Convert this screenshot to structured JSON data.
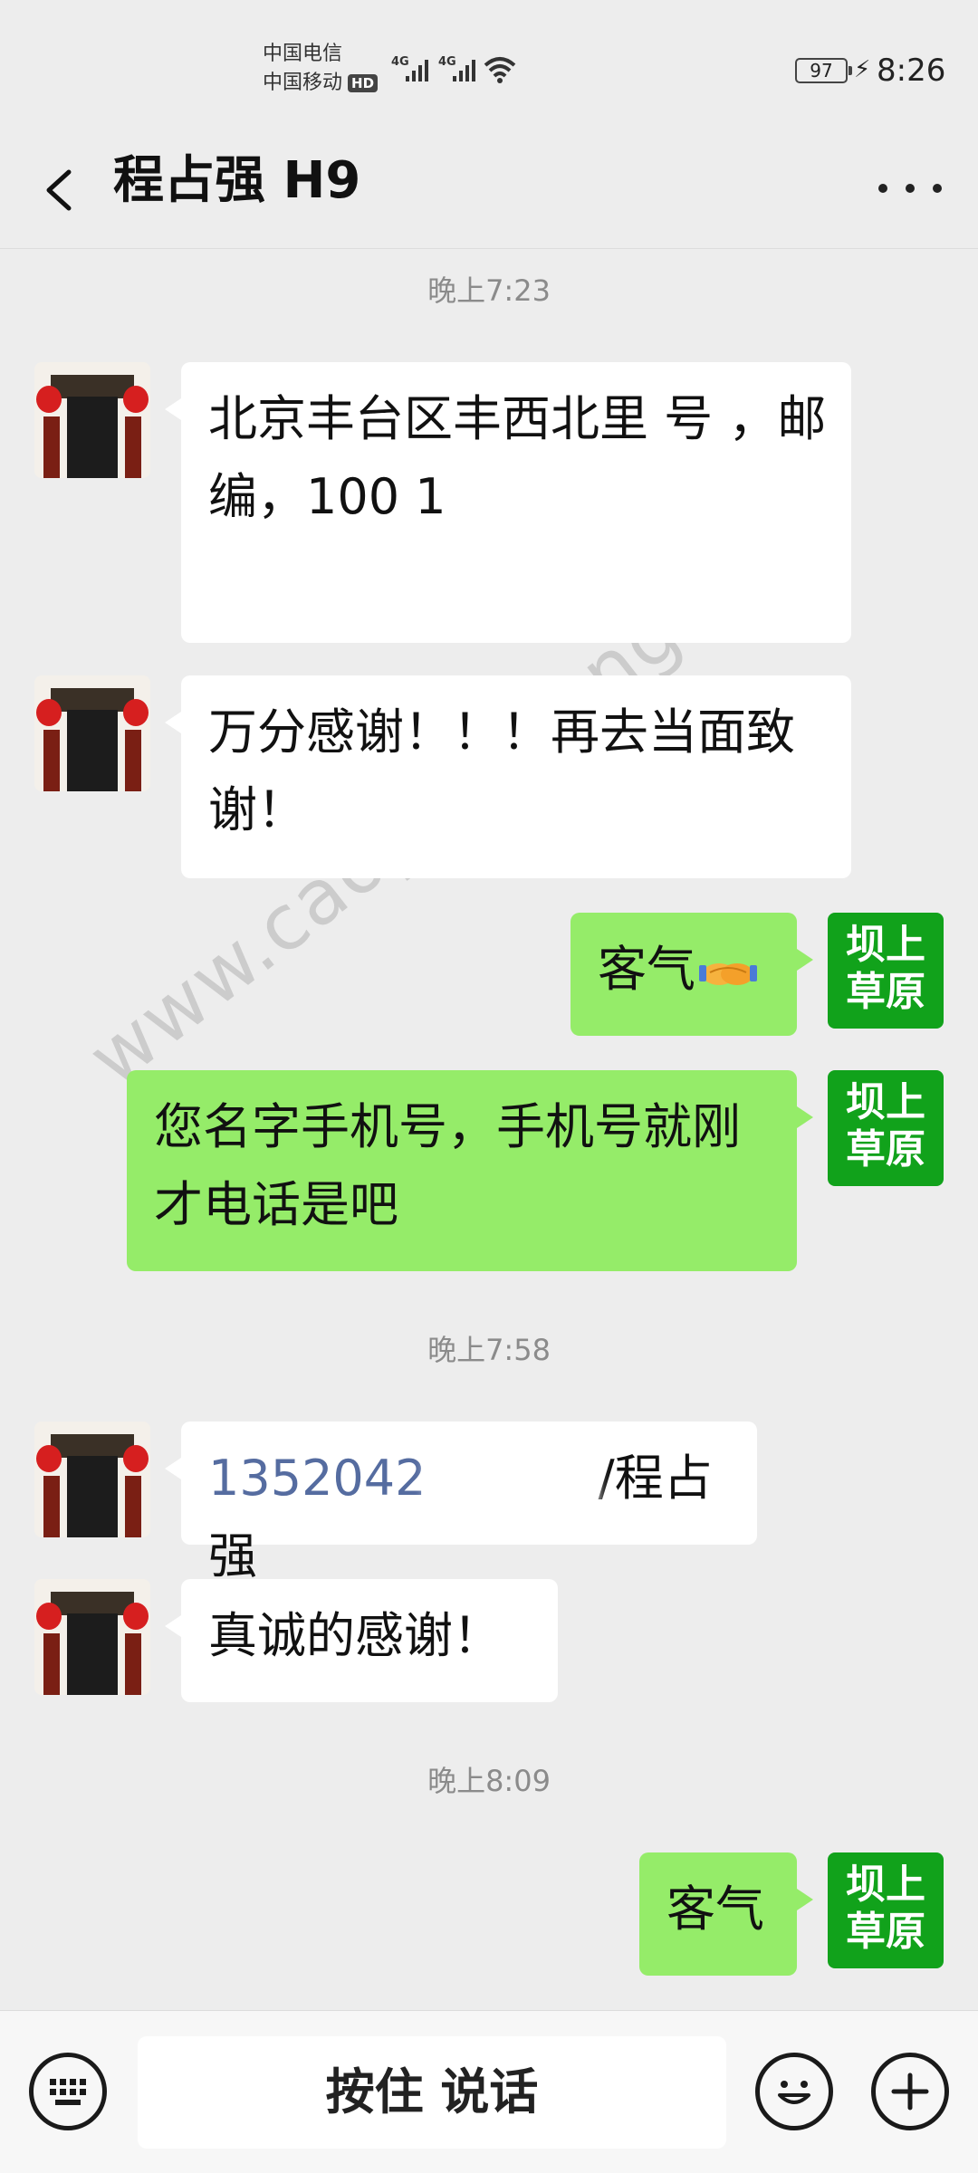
{
  "status_bar": {
    "carrier1": "中国电信",
    "carrier2": "中国移动",
    "hd": "HD",
    "network1": "4G",
    "network2": "4G",
    "battery": "97",
    "time": "8:26"
  },
  "header": {
    "title": "程占强 H9"
  },
  "messages": [
    {
      "type": "time",
      "text": "晚上7:23"
    },
    {
      "type": "in",
      "text": "北京丰台区丰西北里 号 ，邮编，100 1"
    },
    {
      "type": "in",
      "text": "万分感谢！！！再去当面致谢！"
    },
    {
      "type": "out",
      "text": "客气"
    },
    {
      "type": "out",
      "text": "您名字手机号，手机号就刚才电话是吧"
    },
    {
      "type": "time",
      "text": "晚上7:58"
    },
    {
      "type": "in",
      "text_phone": "1352042",
      "text_rest": "/程占强"
    },
    {
      "type": "in",
      "text": "真诚的感谢！"
    },
    {
      "type": "time",
      "text": "晚上8:09"
    },
    {
      "type": "out",
      "text": "客气"
    }
  ],
  "my_avatar": {
    "line1": "坝上",
    "line2": "草原"
  },
  "input_bar": {
    "hold_to_talk": "按住 说话"
  },
  "watermark": "www.caoyuanfeng.com",
  "colors": {
    "background": "#ededed",
    "incoming_bubble": "#ffffff",
    "outgoing_bubble": "#95ec69",
    "phone_link": "#556ca0",
    "my_avatar": "#11a21b"
  },
  "icons": [
    "back-arrow-icon",
    "more-icon",
    "keyboard-icon",
    "emoji-icon",
    "plus-icon",
    "handshake-icon"
  ]
}
